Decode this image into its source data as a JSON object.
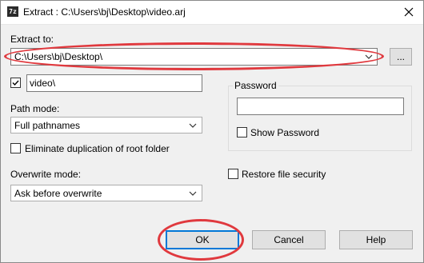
{
  "window": {
    "title": "Extract : C:\\Users\\bj\\Desktop\\video.arj",
    "app_icon_text": "7z"
  },
  "extract_to": {
    "label": "Extract to:",
    "value": "C:\\Users\\bj\\Desktop\\",
    "browse_label": "..."
  },
  "subfolder": {
    "checked": true,
    "value": "video\\"
  },
  "path_mode": {
    "label": "Path mode:",
    "value": "Full pathnames"
  },
  "eliminate_duplication": {
    "label": "Eliminate duplication of root folder",
    "checked": false
  },
  "overwrite_mode": {
    "label": "Overwrite mode:",
    "value": "Ask before overwrite"
  },
  "password": {
    "label": "Password",
    "value": "",
    "show_password_label": "Show Password",
    "show_password_checked": false
  },
  "restore_security": {
    "label": "Restore file security",
    "checked": false
  },
  "buttons": {
    "ok": "OK",
    "cancel": "Cancel",
    "help": "Help"
  },
  "colors": {
    "highlight": "#e0393e",
    "default_button_border": "#0078d7"
  }
}
